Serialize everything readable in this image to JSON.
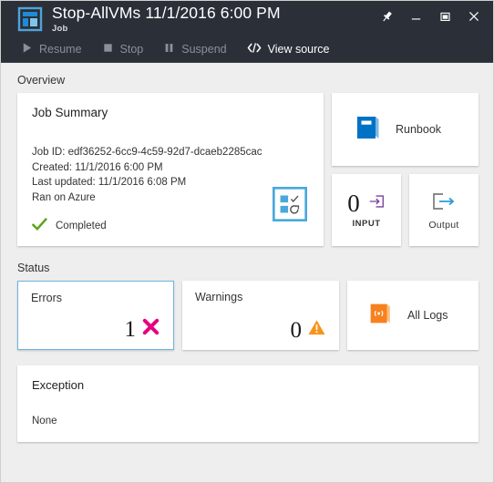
{
  "window": {
    "title": "Stop-AllVMs 11/1/2016 6:00 PM",
    "subtitle": "Job",
    "app_icon": "dashboard-tiles-icon",
    "controls": {
      "pin": "pin-icon",
      "minimize": "minimize-icon",
      "maximize": "maximize-icon",
      "close": "close-icon"
    }
  },
  "commandbar": {
    "items": [
      {
        "label": "Resume",
        "icon": "play-icon",
        "enabled": false
      },
      {
        "label": "Stop",
        "icon": "stop-square-icon",
        "enabled": false
      },
      {
        "label": "Suspend",
        "icon": "pause-icon",
        "enabled": false
      },
      {
        "label": "View source",
        "icon": "code-brackets-icon",
        "enabled": true
      }
    ]
  },
  "overview": {
    "section_label": "Overview",
    "summary": {
      "title": "Job Summary",
      "job_id": "Job ID: edf36252-6cc9-4c59-92d7-dcaeb2285cac",
      "created": "Created: 11/1/2016 6:00 PM",
      "last_updated": "Last updated: 11/1/2016 6:08 PM",
      "ran_on": "Ran on Azure",
      "status": "Completed",
      "status_icon": "green-checkmark-icon",
      "tile_icon": "checklist-icon"
    },
    "runbook": {
      "label": "Runbook",
      "icon": "blue-book-icon"
    },
    "input": {
      "count": "0",
      "label": "INPUT",
      "icon": "input-arrow-icon"
    },
    "output": {
      "label": "Output",
      "icon": "output-arrow-icon"
    }
  },
  "status": {
    "section_label": "Status",
    "errors": {
      "label": "Errors",
      "count": "1",
      "icon": "pink-x-icon",
      "selected": true
    },
    "warnings": {
      "label": "Warnings",
      "count": "0",
      "icon": "orange-warning-triangle-icon",
      "selected": false
    },
    "all_logs": {
      "label": "All Logs",
      "icon": "orange-logs-book-icon"
    }
  },
  "exception": {
    "title": "Exception",
    "body": "None"
  },
  "colors": {
    "titlebar_bg": "#2b2f38",
    "page_bg": "#eeeeee",
    "tile_bg": "#ffffff",
    "accent_blue": "#0072c6",
    "selection_blue": "#6fb4e0",
    "error_pink": "#e6007e",
    "warning_orange": "#f7941d",
    "success_green": "#5aa417",
    "input_purple": "#7b3fa0",
    "logs_orange": "#f7811e"
  }
}
